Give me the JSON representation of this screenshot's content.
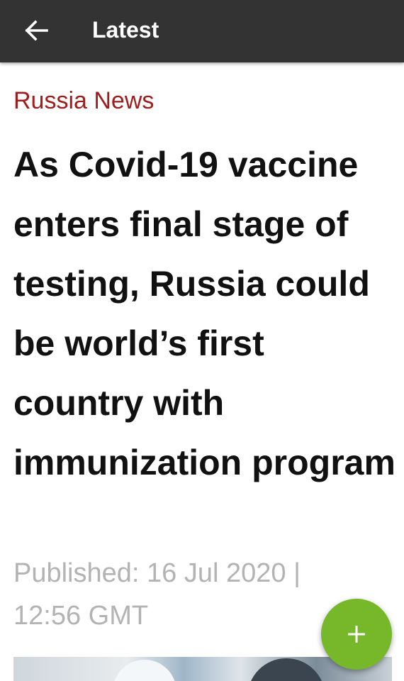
{
  "app_bar": {
    "title": "Latest",
    "back_icon": "arrow-left-icon"
  },
  "article": {
    "category": "Russia News",
    "headline": "As Covid-19 vaccine enters final stage of testing, Russia could be world’s first country with immunization program",
    "published": "Published: 16 Jul 2020 | 12:56 GMT"
  },
  "fab": {
    "icon": "plus-icon"
  },
  "colors": {
    "app_bar_bg": "#333333",
    "category": "#a31c1c",
    "headline": "#111111",
    "meta": "#b3b3b3",
    "fab": "#76b82a"
  }
}
